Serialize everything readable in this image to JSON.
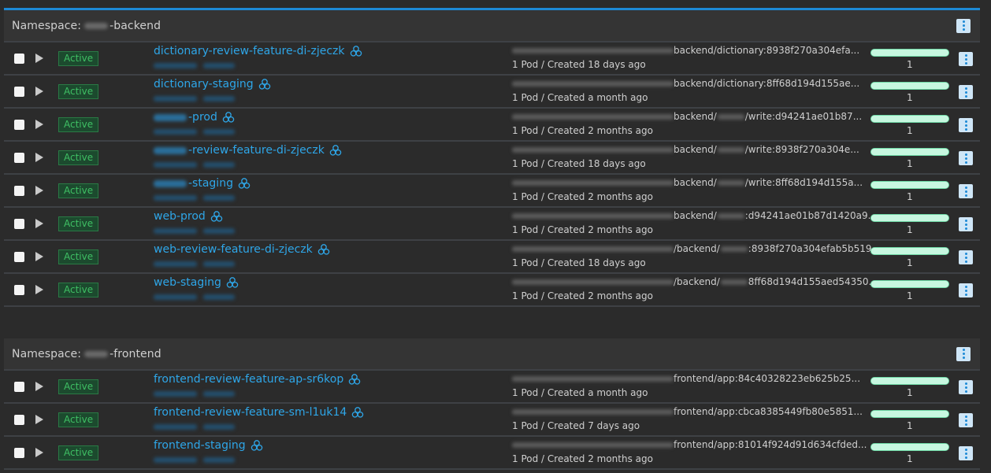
{
  "groups": [
    {
      "namespace_label": "Namespace:",
      "namespace_suffix": "-backend",
      "rows": [
        {
          "status": "Active",
          "name_prefix_blurred": false,
          "name": "dictionary-review-feature-di-zjeczk",
          "image_tail": "backend/dictionary:8938f270a304efa...",
          "image_mid_blurred": false,
          "pods": "1 Pod / Created 18 days ago",
          "scale": 1,
          "ready_fraction": 1.0
        },
        {
          "status": "Active",
          "name_prefix_blurred": false,
          "name": "dictionary-staging",
          "image_tail": "backend/dictionary:8ff68d194d155ae...",
          "image_mid_blurred": false,
          "pods": "1 Pod / Created a month ago",
          "scale": 1,
          "ready_fraction": 1.0
        },
        {
          "status": "Active",
          "name_prefix_blurred": true,
          "name": "-prod",
          "image_head": "backend/",
          "image_tail": "/write:d94241ae01b87...",
          "image_mid_blurred": true,
          "pods": "1 Pod / Created 2 months ago",
          "scale": 1,
          "ready_fraction": 1.0
        },
        {
          "status": "Active",
          "name_prefix_blurred": true,
          "name": "-review-feature-di-zjeczk",
          "image_head": "backend/",
          "image_tail": "/write:8938f270a304e...",
          "image_mid_blurred": true,
          "pods": "1 Pod / Created 18 days ago",
          "scale": 1,
          "ready_fraction": 1.0
        },
        {
          "status": "Active",
          "name_prefix_blurred": true,
          "name": "-staging",
          "image_head": "backend/",
          "image_tail": "/write:8ff68d194d155a...",
          "image_mid_blurred": true,
          "pods": "1 Pod / Created 2 months ago",
          "scale": 1,
          "ready_fraction": 1.0
        },
        {
          "status": "Active",
          "name_prefix_blurred": false,
          "name": "web-prod",
          "image_head": "backend/",
          "image_tail": ":d94241ae01b87d1420a9...",
          "image_mid_blurred": true,
          "pods": "1 Pod / Created 2 months ago",
          "scale": 1,
          "ready_fraction": 1.0
        },
        {
          "status": "Active",
          "name_prefix_blurred": false,
          "name": "web-review-feature-di-zjeczk",
          "image_head": "/backend/",
          "image_tail": ":8938f270a304efab5b519...",
          "image_mid_blurred": true,
          "pods": "1 Pod / Created 18 days ago",
          "scale": 1,
          "ready_fraction": 1.0
        },
        {
          "status": "Active",
          "name_prefix_blurred": false,
          "name": "web-staging",
          "image_head": "/backend/",
          "image_tail": "8ff68d194d155aed54350...",
          "image_mid_blurred": true,
          "pods": "1 Pod / Created 2 months ago",
          "scale": 1,
          "ready_fraction": 1.0
        }
      ]
    },
    {
      "namespace_label": "Namespace:",
      "namespace_suffix": "-frontend",
      "rows": [
        {
          "status": "Active",
          "name_prefix_blurred": false,
          "name": "frontend-review-feature-ap-sr6kop",
          "image_tail": "frontend/app:84c40328223eb625b25...",
          "image_mid_blurred": false,
          "pods": "1 Pod / Created a month ago",
          "scale": 1,
          "ready_fraction": 1.0
        },
        {
          "status": "Active",
          "name_prefix_blurred": false,
          "name": "frontend-review-feature-sm-l1uk14",
          "image_tail": "frontend/app:cbca8385449fb80e5851...",
          "image_mid_blurred": false,
          "pods": "1 Pod / Created 7 days ago",
          "scale": 1,
          "ready_fraction": 1.0
        },
        {
          "status": "Active",
          "name_prefix_blurred": false,
          "name": "frontend-staging",
          "image_tail": "frontend/app:81014f924d91d634cfded...",
          "image_mid_blurred": false,
          "pods": "1 Pod / Created 2 months ago",
          "scale": 1,
          "ready_fraction": 1.0
        }
      ]
    }
  ],
  "colors": {
    "accent": "#1d8ad6",
    "link": "#2ea6e8",
    "active_text": "#3fbf64",
    "active_bg": "#1c4a2e",
    "bar_fill": "#c7f7e0",
    "kebab_bg": "#cfe6f7"
  },
  "icons": {
    "row_name": "cluster-icon",
    "menu": "kebab-menu-icon",
    "expand": "play-triangle-icon",
    "select": "checkbox"
  }
}
